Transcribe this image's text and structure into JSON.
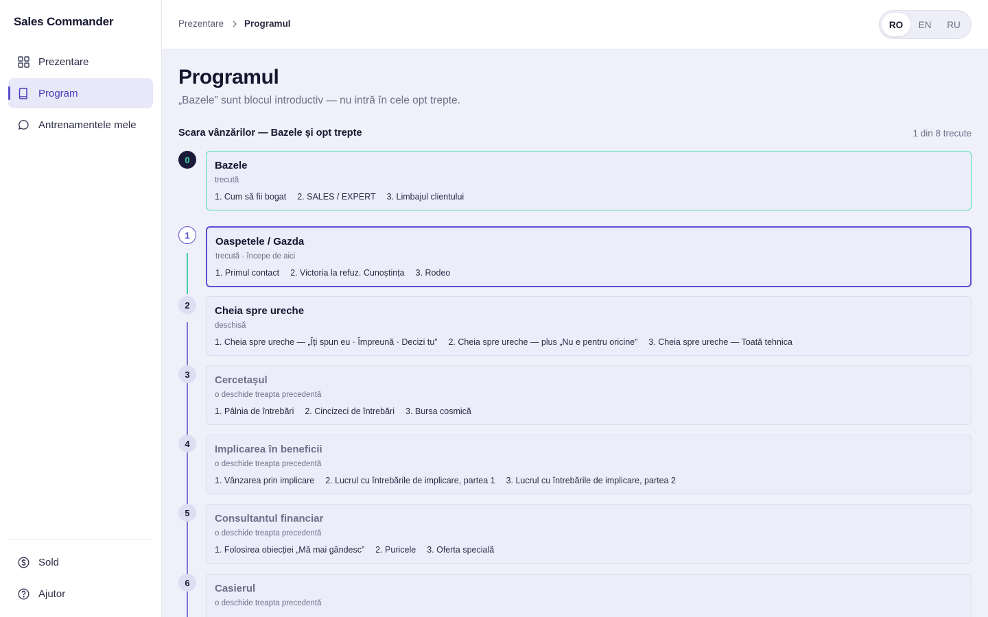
{
  "app": {
    "brand": "Sales Commander"
  },
  "sidebar": {
    "items": [
      {
        "label": "Prezentare",
        "icon": "grid-icon"
      },
      {
        "label": "Program",
        "icon": "book-icon"
      },
      {
        "label": "Antrenamentele mele",
        "icon": "chat-icon"
      }
    ],
    "bottom_items": [
      {
        "label": "Sold",
        "icon": "dollar-circle-icon"
      },
      {
        "label": "Ajutor",
        "icon": "help-circle-icon"
      }
    ]
  },
  "header": {
    "breadcrumb": {
      "parent": "Prezentare",
      "current": "Programul"
    },
    "languages": [
      "RO",
      "EN",
      "RU"
    ],
    "active_language": "RO"
  },
  "main": {
    "title": "Programul",
    "subtitle": "„Bazele” sunt blocul introductiv — nu intră în cele opt trepte.",
    "section_title": "Scara vânzărilor — Bazele și opt trepte",
    "progress_text": "1 din 8 trecute"
  },
  "steps": [
    {
      "num": "0",
      "title": "Bazele",
      "status": "trecută",
      "state": "done",
      "lessons": [
        "1. Cum să fii bogat",
        "2. SALES / EXPERT",
        "3. Limbajul clientului"
      ]
    },
    {
      "num": "1",
      "title": "Oaspetele / Gazda",
      "status": "trecută · începe de aici",
      "state": "current",
      "lessons": [
        "1. Primul contact",
        "2. Victoria la refuz. Cunoștința",
        "3. Rodeo"
      ]
    },
    {
      "num": "2",
      "title": "Cheia spre ureche",
      "status": "deschisă",
      "state": "open",
      "lessons": [
        "1. Cheia spre ureche — „Îți spun eu · Împreună · Decizi tu”",
        "2. Cheia spre ureche — plus „Nu e pentru oricine”",
        "3. Cheia spre ureche — Toată tehnica"
      ]
    },
    {
      "num": "3",
      "title": "Cercetașul",
      "status": "o deschide treapta precedentă",
      "state": "locked",
      "lessons": [
        "1. Pâlnia de întrebări",
        "2. Cincizeci de întrebări",
        "3. Bursa cosmică"
      ]
    },
    {
      "num": "4",
      "title": "Implicarea în beneficii",
      "status": "o deschide treapta precedentă",
      "state": "locked",
      "lessons": [
        "1. Vânzarea prin implicare",
        "2. Lucrul cu întrebările de implicare, partea 1",
        "3. Lucrul cu întrebările de implicare, partea 2"
      ]
    },
    {
      "num": "5",
      "title": "Consultantul financiar",
      "status": "o deschide treapta precedentă",
      "state": "locked",
      "lessons": [
        "1. Folosirea obiecției „Mă mai gândesc”",
        "2. Puricele",
        "3. Oferta specială"
      ]
    },
    {
      "num": "6",
      "title": "Casierul",
      "status": "o deschide treapta precedentă",
      "state": "locked",
      "lessons": []
    }
  ],
  "colors": {
    "accent": "#5b4fd0",
    "done": "#3fd1a5",
    "dark": "#1a1b3a"
  }
}
